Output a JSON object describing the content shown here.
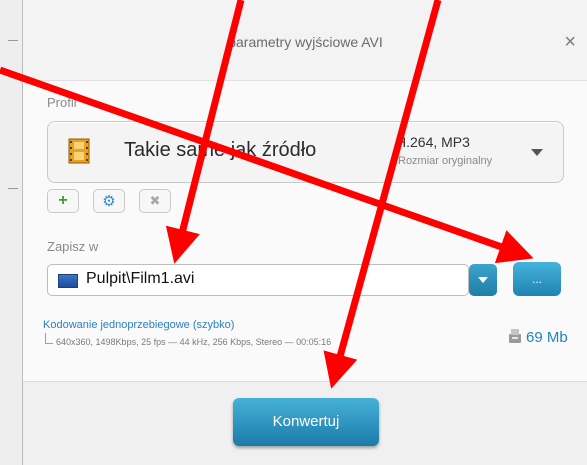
{
  "dialog": {
    "title": "parametry wyjściowe AVI",
    "close_glyph": "×"
  },
  "profile": {
    "section_label": "Profil",
    "name": "Takie same jak źródło",
    "codec": "H.264, MP3",
    "size_note": "Rozmiar oryginalny",
    "icon": "film-icon"
  },
  "profile_buttons": [
    {
      "icon": "plus-icon",
      "glyph": "+"
    },
    {
      "icon": "gear-icon",
      "glyph": "⚙"
    },
    {
      "icon": "x-icon",
      "glyph": "✖"
    }
  ],
  "save": {
    "section_label": "Zapisz w",
    "path": "Pulpit\\Film1.avi",
    "browse_label": "..."
  },
  "encoding": {
    "mode_link": "Kodowanie jednoprzebiegowe (szybko)",
    "details": "640x360, 1498Kbps, 25 fps — 44 kHz, 256 Kbps, Stereo — 00:05:16",
    "output_size": "69 Mb"
  },
  "actions": {
    "convert_label": "Konwertuj"
  },
  "colors": {
    "accent": "#1f84b2",
    "link": "#2b7fc0",
    "annotation_arrow": "#ff0000"
  }
}
